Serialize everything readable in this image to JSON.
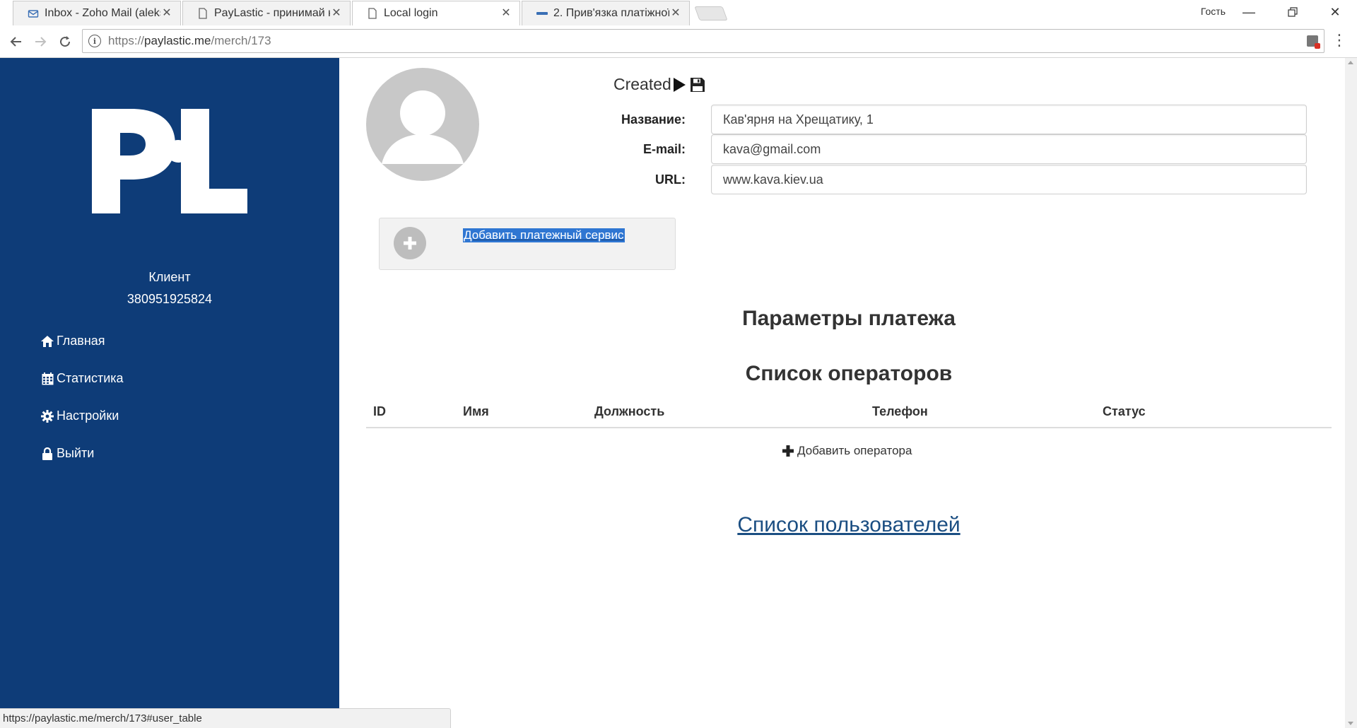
{
  "browser": {
    "tabs": [
      {
        "title": "Inbox - Zoho Mail (aleksa",
        "icon": "zoho-mail-icon",
        "active": false
      },
      {
        "title": "PayLastic - принимай кар",
        "icon": "page-icon",
        "active": false
      },
      {
        "title": "Local login",
        "icon": "page-icon",
        "active": true
      },
      {
        "title": "2. Прив'язка платіжної к",
        "icon": "paylastic-favicon",
        "active": false
      }
    ],
    "guest_label": "Гость",
    "url": {
      "scheme": "https://",
      "host": "paylastic.me",
      "path": "/merch/173"
    },
    "status_url": "https://paylastic.me/merch/173#user_table"
  },
  "sidebar": {
    "logo_text": "PL",
    "client_label": "Клиент",
    "client_phone": "380951925824",
    "menu": [
      {
        "label": "Главная",
        "icon": "home-icon"
      },
      {
        "label": "Статистика",
        "icon": "calendar-icon"
      },
      {
        "label": "Настройки",
        "icon": "gear-icon"
      },
      {
        "label": "Выйти",
        "icon": "lock-icon"
      }
    ]
  },
  "merchant": {
    "status": "Created",
    "fields": {
      "name": {
        "label": "Название:",
        "value": "Кав'ярня на Хрещатику, 1"
      },
      "email": {
        "label": "E-mail:",
        "value": "kava@gmail.com"
      },
      "url": {
        "label": "URL:",
        "value": "www.kava.kiev.ua"
      }
    },
    "add_service_label": "Добавить платежный сервис"
  },
  "sections": {
    "payment_params_title": "Параметры платежа",
    "operators_title": "Список операторов",
    "operators_columns": [
      "ID",
      "Имя",
      "Должность",
      "Телефон",
      "Статус"
    ],
    "add_operator_label": "Добавить оператора",
    "users_link": "Список пользователей"
  },
  "colors": {
    "sidebar_bg": "#0e3c78",
    "link": "#1b4e82",
    "selection": "#2f76d2"
  }
}
